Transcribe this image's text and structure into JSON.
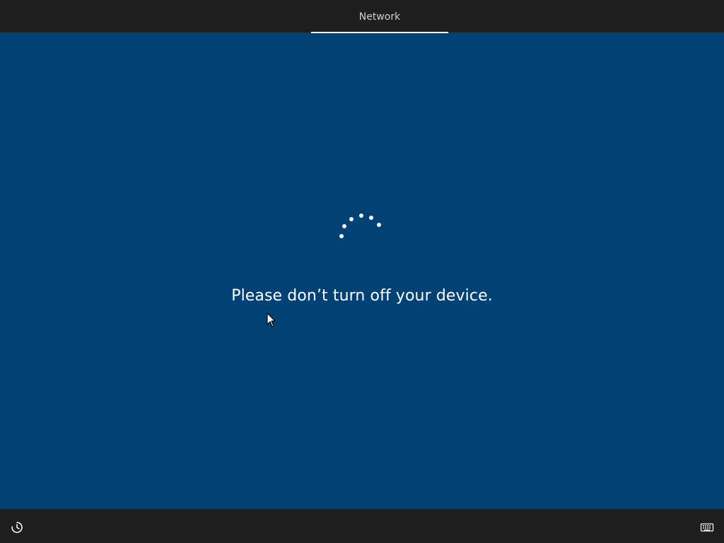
{
  "header": {
    "step_label": "Network"
  },
  "main": {
    "message": "Please don’t turn off your device."
  },
  "footer": {
    "left_icon": "ease-of-access-icon",
    "right_icon": "keyboard-icon"
  },
  "colors": {
    "background": "#004275",
    "bars": "#1f1f1f",
    "text": "#ffffff",
    "step_text": "#cfcfcf"
  }
}
